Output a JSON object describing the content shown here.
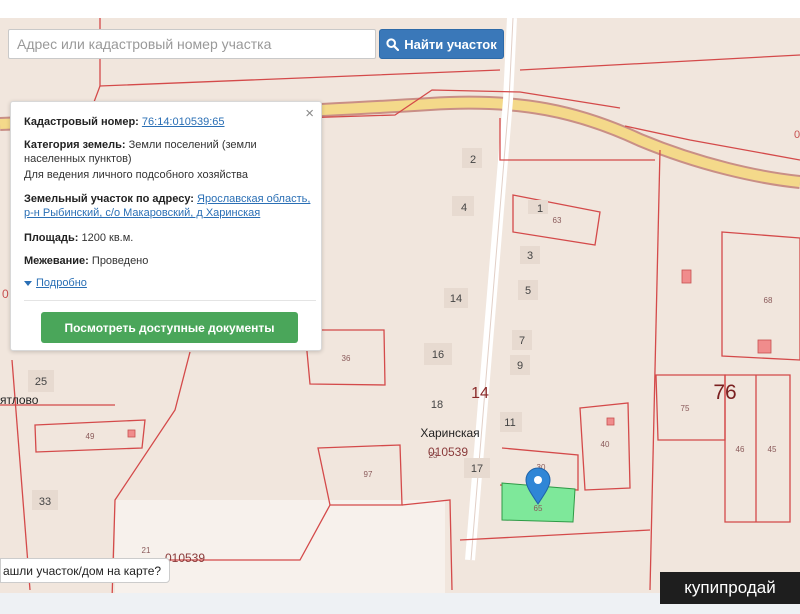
{
  "search": {
    "placeholder": "Адрес или кадастровый номер участка",
    "button_label": "Найти участок",
    "button_icon": "search-icon"
  },
  "popup": {
    "cadastral_label": "Кадастровый номер:",
    "cadastral_value": "76:14:010539:65",
    "category_label": "Категория земель:",
    "category_value": "Земли поселений (земли населенных пунктов)",
    "category_use": "Для ведения личного подсобного хозяйства",
    "address_label": "Земельный участок по адресу:",
    "address_value": "Ярославская область, р-н Рыбинский, с/о Макаровский, д Харинская",
    "area_label": "Площадь:",
    "area_value": "1200 кв.м.",
    "survey_label": "Межевание:",
    "survey_value": "Проведено",
    "more_link": "Подробно",
    "docs_button": "Посмотреть доступные документы",
    "close_icon": "close-icon"
  },
  "map": {
    "colors": {
      "background": "#f1e6dd",
      "parcel_line": "#d44a4a",
      "road": "#f4d98a",
      "selected_parcel": "#7ee89a",
      "marker": "#2f86d6",
      "bottom_bar": "#eef1f4"
    },
    "village_label": "Харинская",
    "village_left_label": "ятлово",
    "block_labels": [
      "010539",
      "010539"
    ],
    "quarter_labels": [
      "14",
      "76"
    ],
    "house_numbers": [
      "2",
      "4",
      "1",
      "3",
      "5",
      "7",
      "9",
      "11",
      "14",
      "16",
      "18",
      "17",
      "25",
      "33"
    ],
    "parcel_numbers": [
      "63",
      "68",
      "75",
      "46",
      "45",
      "40",
      "36",
      "49",
      "97",
      "30",
      "65",
      "23",
      "21"
    ],
    "partial_labels": [
      "0",
      "0"
    ]
  },
  "found_prompt": "ашли участок/дом на карте?",
  "watermark": "купипродай"
}
